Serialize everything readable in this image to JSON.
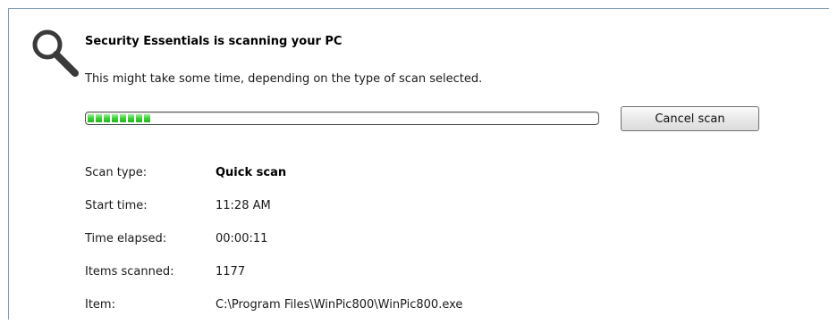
{
  "header": {
    "title": "Security Essentials is scanning your PC",
    "subtitle": "This might take some time, depending on the type of scan selected."
  },
  "progress": {
    "fraction": 0.2,
    "segments": 8
  },
  "buttons": {
    "cancel_label": "Cancel scan"
  },
  "details": [
    {
      "label": "Scan type:",
      "value": "Quick scan",
      "bold": true
    },
    {
      "label": "Start time:",
      "value": "11:28 AM",
      "bold": false
    },
    {
      "label": "Time elapsed:",
      "value": "00:00:11",
      "bold": false
    },
    {
      "label": "Items scanned:",
      "value": "1177",
      "bold": false
    },
    {
      "label": "Item:",
      "value": "C:\\Program Files\\WinPic800\\WinPic800.exe",
      "bold": false
    }
  ],
  "icons": {
    "header_icon": "magnifier-icon"
  },
  "colors": {
    "progress_green": "#3fcf3a",
    "panel_border": "#7f9db9"
  }
}
